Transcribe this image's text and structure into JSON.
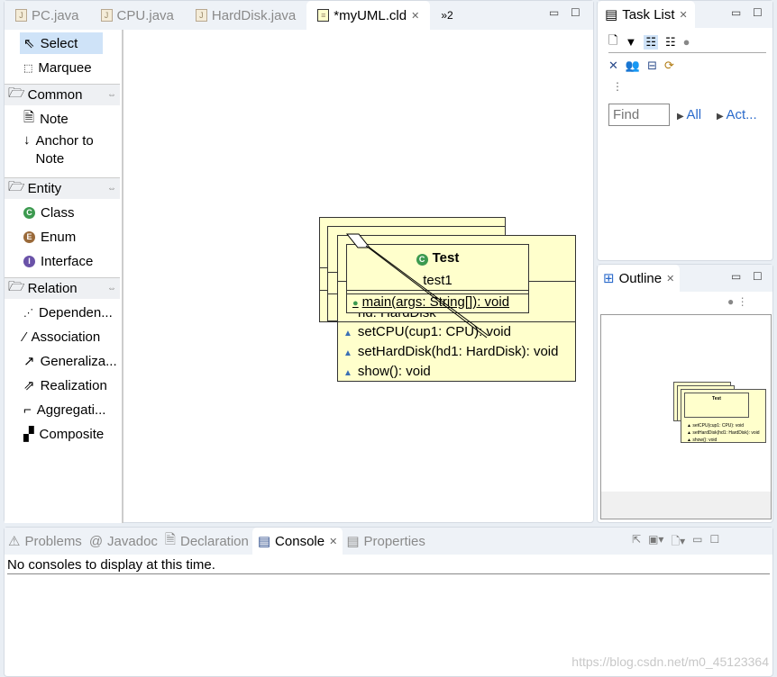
{
  "editor": {
    "tabs": [
      {
        "label": "PC.java"
      },
      {
        "label": "CPU.java"
      },
      {
        "label": "HardDisk.java"
      },
      {
        "label": "*myUML.cld"
      }
    ],
    "overflow": "»2"
  },
  "palette": {
    "tools": [
      {
        "label": "Select"
      },
      {
        "label": "Marquee"
      }
    ],
    "sections": [
      {
        "label": "Common",
        "items": [
          {
            "label": "Note"
          },
          {
            "label": "Anchor to Note"
          }
        ]
      },
      {
        "label": "Entity",
        "items": [
          {
            "label": "Class"
          },
          {
            "label": "Enum"
          },
          {
            "label": "Interface"
          }
        ]
      },
      {
        "label": "Relation",
        "items": [
          {
            "label": "Dependen..."
          },
          {
            "label": "Association"
          },
          {
            "label": "Generaliza..."
          },
          {
            "label": "Realization"
          },
          {
            "label": "Aggregati..."
          },
          {
            "label": "Composite"
          }
        ]
      }
    ]
  },
  "diagram": {
    "test_class": {
      "name": "Test",
      "attribute": "test1",
      "method": "main(args: String[]): void"
    },
    "pc_class": {
      "hidden_attr": "hd: HardDisk",
      "methods": [
        "setCPU(cup1: CPU): void",
        "setHardDisk(hd1: HardDisk): void",
        "show(): void"
      ]
    }
  },
  "task_list": {
    "title": "Task List",
    "find_placeholder": "Find",
    "all": "All",
    "activate": "Act..."
  },
  "outline": {
    "title": "Outline"
  },
  "bottom": {
    "tabs": [
      {
        "label": "Problems"
      },
      {
        "label": "Javadoc"
      },
      {
        "label": "Declaration"
      },
      {
        "label": "Console"
      },
      {
        "label": "Properties"
      }
    ],
    "message": "No consoles to display at this time."
  },
  "watermark": "https://blog.csdn.net/m0_45123364",
  "colors": {
    "class_fill": "#ffffcc",
    "selection": "#cfe3f8",
    "link": "#2a6acb"
  }
}
